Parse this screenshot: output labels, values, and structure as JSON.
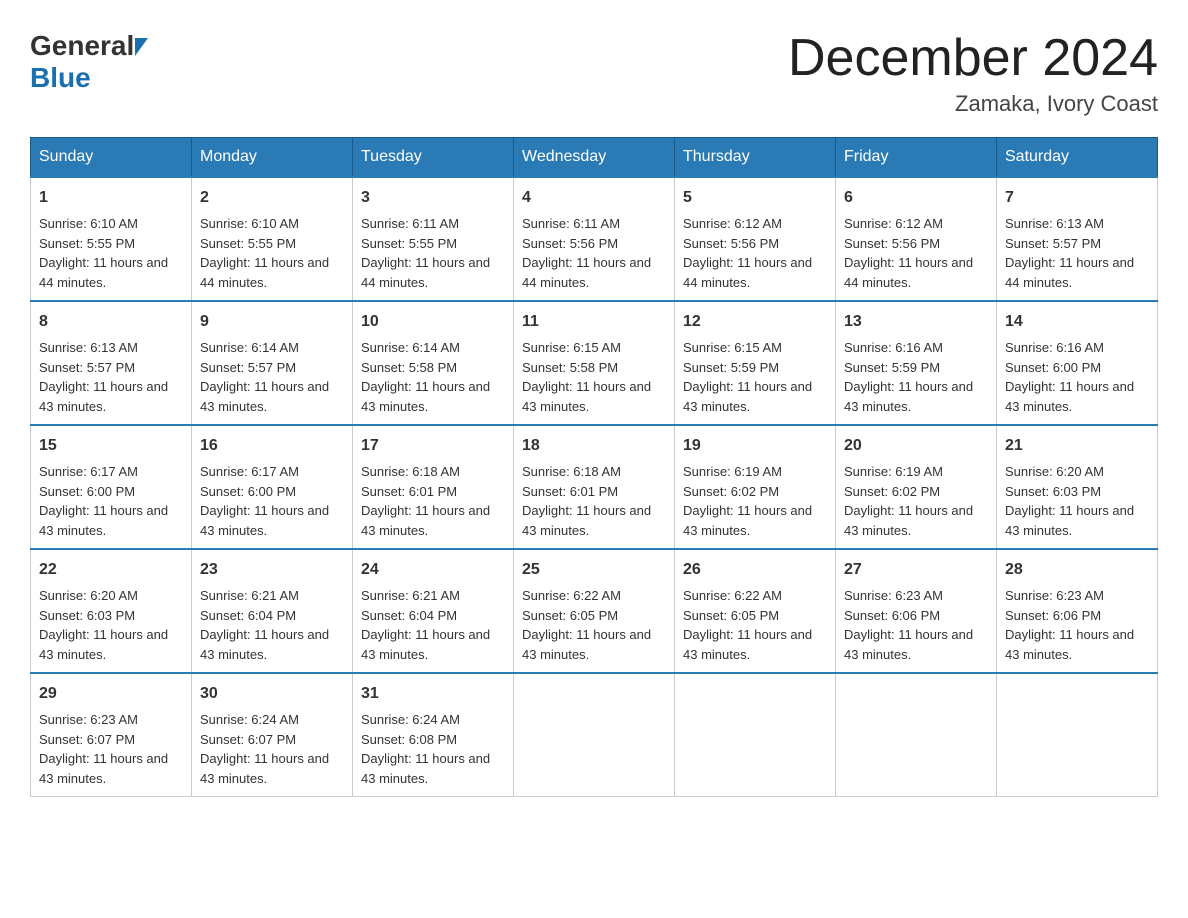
{
  "header": {
    "logo_general": "General",
    "logo_blue": "Blue",
    "title": "December 2024",
    "subtitle": "Zamaka, Ivory Coast"
  },
  "calendar": {
    "days": [
      "Sunday",
      "Monday",
      "Tuesday",
      "Wednesday",
      "Thursday",
      "Friday",
      "Saturday"
    ],
    "weeks": [
      [
        {
          "day": "1",
          "sunrise": "6:10 AM",
          "sunset": "5:55 PM",
          "daylight": "11 hours and 44 minutes."
        },
        {
          "day": "2",
          "sunrise": "6:10 AM",
          "sunset": "5:55 PM",
          "daylight": "11 hours and 44 minutes."
        },
        {
          "day": "3",
          "sunrise": "6:11 AM",
          "sunset": "5:55 PM",
          "daylight": "11 hours and 44 minutes."
        },
        {
          "day": "4",
          "sunrise": "6:11 AM",
          "sunset": "5:56 PM",
          "daylight": "11 hours and 44 minutes."
        },
        {
          "day": "5",
          "sunrise": "6:12 AM",
          "sunset": "5:56 PM",
          "daylight": "11 hours and 44 minutes."
        },
        {
          "day": "6",
          "sunrise": "6:12 AM",
          "sunset": "5:56 PM",
          "daylight": "11 hours and 44 minutes."
        },
        {
          "day": "7",
          "sunrise": "6:13 AM",
          "sunset": "5:57 PM",
          "daylight": "11 hours and 44 minutes."
        }
      ],
      [
        {
          "day": "8",
          "sunrise": "6:13 AM",
          "sunset": "5:57 PM",
          "daylight": "11 hours and 43 minutes."
        },
        {
          "day": "9",
          "sunrise": "6:14 AM",
          "sunset": "5:57 PM",
          "daylight": "11 hours and 43 minutes."
        },
        {
          "day": "10",
          "sunrise": "6:14 AM",
          "sunset": "5:58 PM",
          "daylight": "11 hours and 43 minutes."
        },
        {
          "day": "11",
          "sunrise": "6:15 AM",
          "sunset": "5:58 PM",
          "daylight": "11 hours and 43 minutes."
        },
        {
          "day": "12",
          "sunrise": "6:15 AM",
          "sunset": "5:59 PM",
          "daylight": "11 hours and 43 minutes."
        },
        {
          "day": "13",
          "sunrise": "6:16 AM",
          "sunset": "5:59 PM",
          "daylight": "11 hours and 43 minutes."
        },
        {
          "day": "14",
          "sunrise": "6:16 AM",
          "sunset": "6:00 PM",
          "daylight": "11 hours and 43 minutes."
        }
      ],
      [
        {
          "day": "15",
          "sunrise": "6:17 AM",
          "sunset": "6:00 PM",
          "daylight": "11 hours and 43 minutes."
        },
        {
          "day": "16",
          "sunrise": "6:17 AM",
          "sunset": "6:00 PM",
          "daylight": "11 hours and 43 minutes."
        },
        {
          "day": "17",
          "sunrise": "6:18 AM",
          "sunset": "6:01 PM",
          "daylight": "11 hours and 43 minutes."
        },
        {
          "day": "18",
          "sunrise": "6:18 AM",
          "sunset": "6:01 PM",
          "daylight": "11 hours and 43 minutes."
        },
        {
          "day": "19",
          "sunrise": "6:19 AM",
          "sunset": "6:02 PM",
          "daylight": "11 hours and 43 minutes."
        },
        {
          "day": "20",
          "sunrise": "6:19 AM",
          "sunset": "6:02 PM",
          "daylight": "11 hours and 43 minutes."
        },
        {
          "day": "21",
          "sunrise": "6:20 AM",
          "sunset": "6:03 PM",
          "daylight": "11 hours and 43 minutes."
        }
      ],
      [
        {
          "day": "22",
          "sunrise": "6:20 AM",
          "sunset": "6:03 PM",
          "daylight": "11 hours and 43 minutes."
        },
        {
          "day": "23",
          "sunrise": "6:21 AM",
          "sunset": "6:04 PM",
          "daylight": "11 hours and 43 minutes."
        },
        {
          "day": "24",
          "sunrise": "6:21 AM",
          "sunset": "6:04 PM",
          "daylight": "11 hours and 43 minutes."
        },
        {
          "day": "25",
          "sunrise": "6:22 AM",
          "sunset": "6:05 PM",
          "daylight": "11 hours and 43 minutes."
        },
        {
          "day": "26",
          "sunrise": "6:22 AM",
          "sunset": "6:05 PM",
          "daylight": "11 hours and 43 minutes."
        },
        {
          "day": "27",
          "sunrise": "6:23 AM",
          "sunset": "6:06 PM",
          "daylight": "11 hours and 43 minutes."
        },
        {
          "day": "28",
          "sunrise": "6:23 AM",
          "sunset": "6:06 PM",
          "daylight": "11 hours and 43 minutes."
        }
      ],
      [
        {
          "day": "29",
          "sunrise": "6:23 AM",
          "sunset": "6:07 PM",
          "daylight": "11 hours and 43 minutes."
        },
        {
          "day": "30",
          "sunrise": "6:24 AM",
          "sunset": "6:07 PM",
          "daylight": "11 hours and 43 minutes."
        },
        {
          "day": "31",
          "sunrise": "6:24 AM",
          "sunset": "6:08 PM",
          "daylight": "11 hours and 43 minutes."
        },
        null,
        null,
        null,
        null
      ]
    ],
    "labels": {
      "sunrise": "Sunrise:",
      "sunset": "Sunset:",
      "daylight": "Daylight:"
    }
  }
}
